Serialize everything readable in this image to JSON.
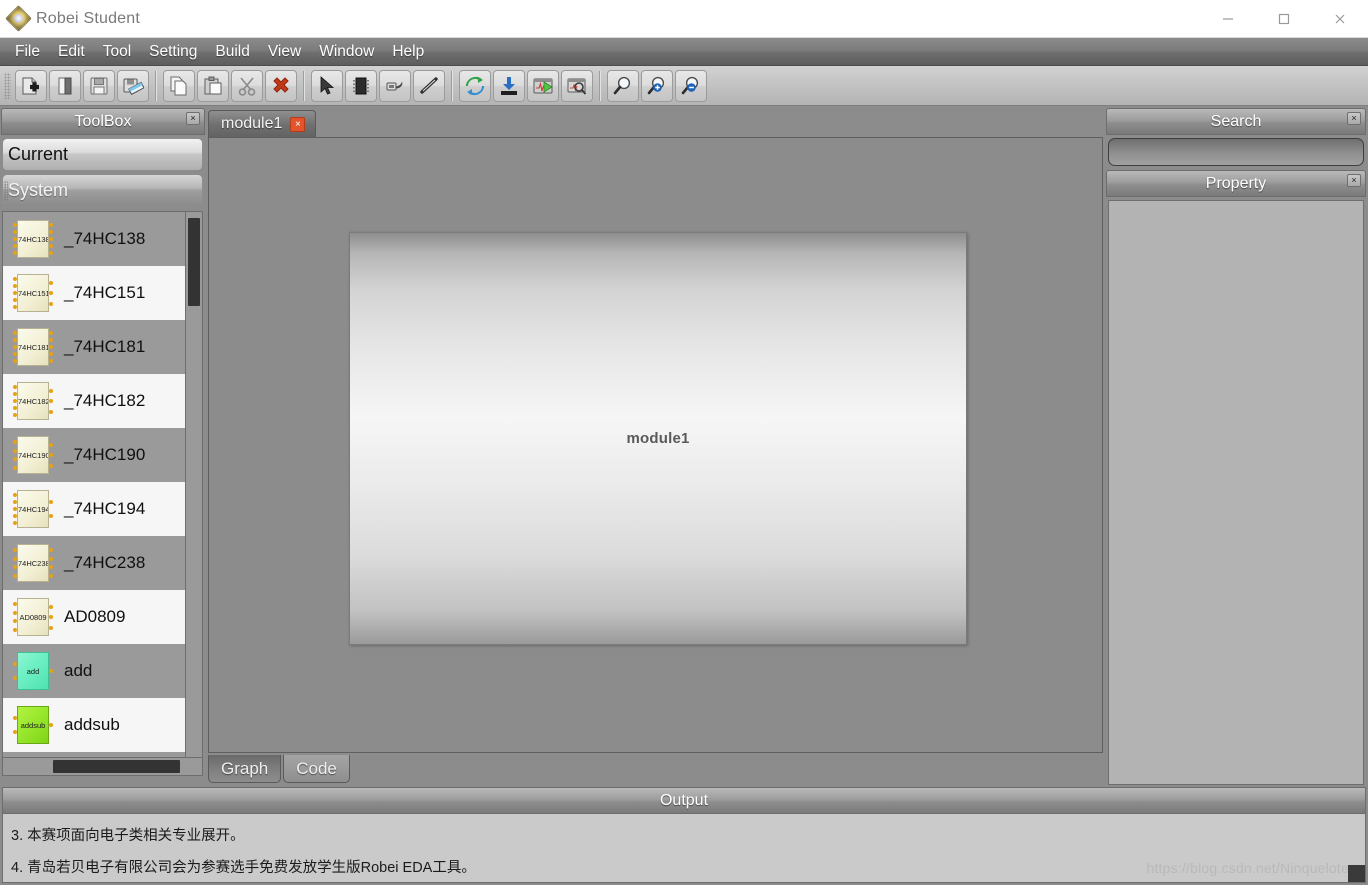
{
  "window": {
    "title": "Robei  Student",
    "logo_icon": "robei-logo-icon",
    "minimize_label": "—",
    "maximize_label": "□",
    "close_label": "✕"
  },
  "menubar": {
    "items": [
      {
        "label": "File"
      },
      {
        "label": "Edit"
      },
      {
        "label": "Tool"
      },
      {
        "label": "Setting"
      },
      {
        "label": "Build"
      },
      {
        "label": "View"
      },
      {
        "label": "Window"
      },
      {
        "label": "Help"
      }
    ]
  },
  "toolbar": {
    "groups": [
      {
        "buttons": [
          {
            "icon": "new-file-icon",
            "tip": "New"
          },
          {
            "icon": "open-project-icon",
            "tip": "Open"
          },
          {
            "icon": "save-icon",
            "tip": "Save"
          },
          {
            "icon": "save-as-icon",
            "tip": "Save As"
          }
        ]
      },
      {
        "buttons": [
          {
            "icon": "copy-icon",
            "tip": "Copy"
          },
          {
            "icon": "paste-icon",
            "tip": "Paste"
          },
          {
            "icon": "cut-scissors-icon",
            "tip": "Cut"
          },
          {
            "icon": "delete-red-x-icon",
            "tip": "Delete"
          }
        ]
      },
      {
        "buttons": [
          {
            "icon": "select-arrow-icon",
            "tip": "Select"
          },
          {
            "icon": "chip-module-icon",
            "tip": "Module"
          },
          {
            "icon": "port-plug-icon",
            "tip": "Port"
          },
          {
            "icon": "wire-line-icon",
            "tip": "Wire"
          }
        ]
      },
      {
        "buttons": [
          {
            "icon": "refresh-sync-icon",
            "tip": "Refresh"
          },
          {
            "icon": "download-icon",
            "tip": "Download"
          },
          {
            "icon": "run-simulate-icon",
            "tip": "Run"
          },
          {
            "icon": "inspect-waveform-icon",
            "tip": "Inspect"
          }
        ]
      },
      {
        "buttons": [
          {
            "icon": "zoom-fit-icon",
            "tip": "Zoom Fit"
          },
          {
            "icon": "zoom-in-icon",
            "tip": "Zoom In"
          },
          {
            "icon": "zoom-out-icon",
            "tip": "Zoom Out"
          }
        ]
      }
    ]
  },
  "toolbox": {
    "title": "ToolBox",
    "close_label": "×",
    "sections": [
      {
        "label": "Current",
        "state": "light"
      },
      {
        "label": "System",
        "state": "dark"
      }
    ],
    "components": [
      {
        "label": "_74HC138",
        "chip_text": "74HC138",
        "color": "cream"
      },
      {
        "label": "_74HC151",
        "chip_text": "74HC151",
        "color": "cream"
      },
      {
        "label": "_74HC181",
        "chip_text": "74HC181",
        "color": "cream"
      },
      {
        "label": "_74HC182",
        "chip_text": "74HC182",
        "color": "cream"
      },
      {
        "label": "_74HC190",
        "chip_text": "74HC190",
        "color": "cream"
      },
      {
        "label": "_74HC194",
        "chip_text": "74HC194",
        "color": "cream"
      },
      {
        "label": "_74HC238",
        "chip_text": "74HC238",
        "color": "cream"
      },
      {
        "label": "AD0809",
        "chip_text": "AD0809",
        "color": "cream"
      },
      {
        "label": "add",
        "chip_text": "add",
        "color": "green"
      },
      {
        "label": "addsub",
        "chip_text": "addsub",
        "color": "lime"
      }
    ]
  },
  "editor": {
    "tabs": [
      {
        "label": "module1",
        "close_label": "×",
        "active": true
      }
    ],
    "canvas": {
      "module_label": "module1"
    },
    "bottom_tabs": [
      {
        "label": "Graph",
        "active": true
      },
      {
        "label": "Code",
        "active": false
      }
    ]
  },
  "search_panel": {
    "title": "Search",
    "close_label": "×",
    "input_value": "",
    "placeholder": ""
  },
  "property_panel": {
    "title": "Property",
    "close_label": "×"
  },
  "output_panel": {
    "title": "Output",
    "lines": [
      "3. 本赛项面向电子类相关专业展开。",
      "4. 青岛若贝电子有限公司会为参赛选手免费发放学生版Robei EDA工具。"
    ],
    "watermark": "https://blog.csdn.net/Ninquelote"
  },
  "colors": {
    "canvas_bg": "#8c8c8c",
    "panel_bg": "#b3b3b3",
    "accent_red": "#e2542b",
    "chip_cream": "#f3f0d6",
    "chip_green": "#6ff0c5",
    "chip_lime": "#9ae82e",
    "pin": "#e6a215"
  }
}
